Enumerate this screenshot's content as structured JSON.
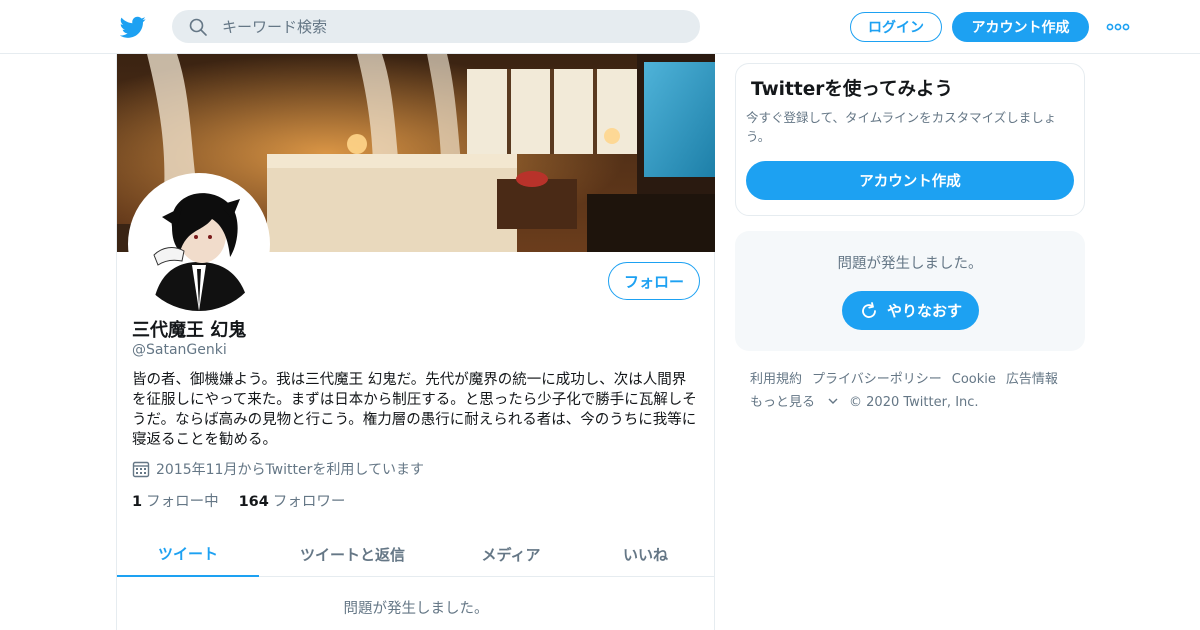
{
  "header": {
    "logo_icon": "twitter-bird-icon",
    "search_placeholder": "キーワード検索",
    "login_label": "ログイン",
    "signup_label": "アカウント作成",
    "more_icon": "more-dots-icon"
  },
  "profile": {
    "name": "三代魔王 幻鬼",
    "handle": "@SatanGenki",
    "follow_label": "フォロー",
    "bio": "皆の者、御機嫌よう。我は三代魔王 幻鬼だ。先代が魔界の統一に成功し、次は人間界を征服しにやって来た。まずは日本から制圧する。と思ったら少子化で勝手に瓦解しそうだ。ならば高みの見物と行こう。権力層の愚行に耐えられる者は、今のうちに我等に寝返ることを勧める。",
    "joined": "2015年11月からTwitterを利用しています",
    "following_count": "1",
    "following_label": "フォロー中",
    "followers_count": "164",
    "followers_label": "フォロワー"
  },
  "tabs": [
    {
      "label": "ツイート",
      "active": true
    },
    {
      "label": "ツイートと返信",
      "active": false
    },
    {
      "label": "メディア",
      "active": false
    },
    {
      "label": "いいね",
      "active": false
    }
  ],
  "main_error": "問題が発生しました。",
  "sidebar": {
    "signup_card": {
      "title": "Twitterを使ってみよう",
      "description": "今すぐ登録して、タイムラインをカスタマイズしましょう。",
      "button_label": "アカウント作成"
    },
    "error_card": {
      "message": "問題が発生しました。",
      "retry_label": "やりなおす"
    },
    "footer": {
      "links": [
        "利用規約",
        "プライバシーポリシー",
        "Cookie",
        "広告情報",
        "もっと見る"
      ],
      "copyright": "© 2020 Twitter, Inc."
    }
  },
  "colors": {
    "accent": "#1da1f2",
    "muted_text": "#657786",
    "border": "#e6ecf0"
  }
}
